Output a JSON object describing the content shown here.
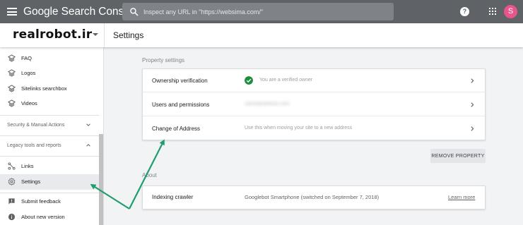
{
  "app": {
    "title": "Google Search Console"
  },
  "search": {
    "placeholder": "Inspect any URL in \"https://websima.com/\""
  },
  "user": {
    "avatar_letter": "S",
    "avatar_color": "#e8558a"
  },
  "property": {
    "name": "realrobot.ir"
  },
  "page": {
    "title": "Settings"
  },
  "sidebar": {
    "items_top": [
      {
        "label": "FAQ",
        "icon": "layers-icon"
      },
      {
        "label": "Logos",
        "icon": "layers-icon"
      },
      {
        "label": "Sitelinks searchbox",
        "icon": "layers-icon"
      },
      {
        "label": "Videos",
        "icon": "layers-icon"
      }
    ],
    "sections": [
      {
        "label": "Security & Manual Actions"
      },
      {
        "label": "Legacy tools and reports"
      }
    ],
    "items_bottom": [
      {
        "label": "Links",
        "icon": "links-icon"
      },
      {
        "label": "Settings",
        "icon": "gear-icon",
        "active": true
      },
      {
        "label": "Submit feedback",
        "icon": "feedback-icon"
      },
      {
        "label": "About new version",
        "icon": "info-icon"
      }
    ]
  },
  "property_settings": {
    "heading": "Property settings",
    "rows": [
      {
        "title": "Ownership verification",
        "desc": "You are a verified owner",
        "icon": "check-circle-icon"
      },
      {
        "title": "Users and permissions",
        "desc": "name@website.com"
      },
      {
        "title": "Change of Address",
        "desc": "Use this when moving your site to a new address"
      }
    ],
    "remove_label": "REMOVE PROPERTY"
  },
  "about": {
    "heading": "About",
    "row": {
      "title": "Indexing crawler",
      "value": "Googlebot Smartphone (switched on September 7, 2018)",
      "link": "Learn more"
    }
  },
  "colors": {
    "topbar": "#5f6368",
    "accent_green": "#1e8e3e",
    "annotation_arrow": "#1e9e6b"
  }
}
